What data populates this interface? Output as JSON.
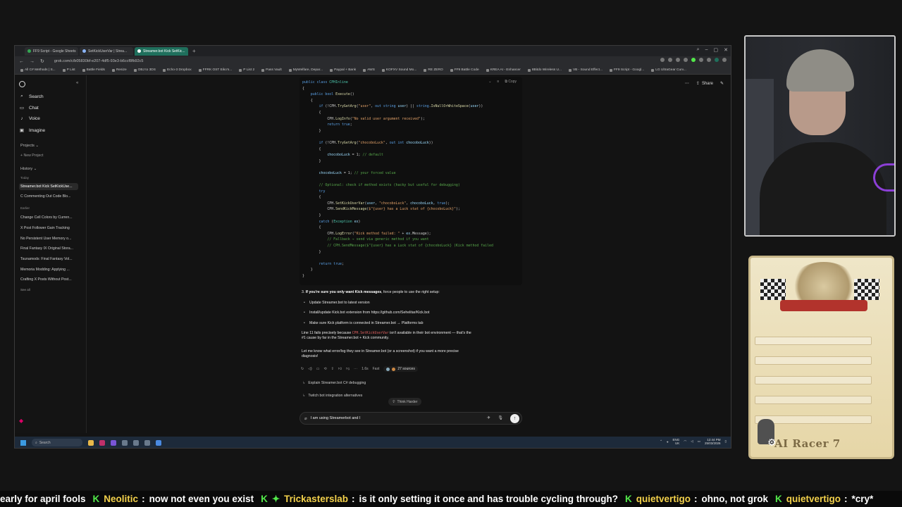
{
  "browser": {
    "tabs": [
      {
        "label": "FF9 Script - Google Sheets",
        "active": false
      },
      {
        "label": "SetKickUserVar | Strea...",
        "active": false
      },
      {
        "label": "Streamer.bot Kick SetKic...",
        "active": true
      }
    ],
    "url": "grok.com/c/b05830bf-e207-4df5-93e3-b6ccf8fb92c5",
    "bookmarks": [
      "All C# Methods | S...",
      "P List",
      "Battle Fields",
      "Resize",
      "OBJ to 3DS",
      "Echo-3 Dropbox",
      "FFRK OST Eiko's...",
      "P List 2",
      "Pass Vault",
      "MyWelfare, Depar...",
      "Paypal + Bank",
      "AWS",
      "KOFXV Sound Mo...",
      "RE ZERO",
      "FF9 Battle Code",
      "KREA AI - Enhancer",
      "8Bitdo Wireless U...",
      "VB - Sound Effect...",
      "FF9 Script - Googl...",
      "LG UltraGear Curv..."
    ]
  },
  "sidebar": {
    "nav": [
      {
        "label": "Search",
        "icon": "search-icon"
      },
      {
        "label": "Chat",
        "icon": "chat-icon"
      },
      {
        "label": "Voice",
        "icon": "voice-icon"
      },
      {
        "label": "Imagine",
        "icon": "image-icon"
      }
    ],
    "projects_label": "Projects",
    "new_project": "New Project",
    "history_label": "History",
    "today_label": "Today",
    "today_items": [
      "Streamer.bot Kick SetKickUse...",
      "C Commenting Out Code Blo..."
    ],
    "earlier_label": "Earlier",
    "earlier_items": [
      "Change Cell Colors by Curren...",
      "X Post Follower Gain Tracking",
      "No Persistent User Memory o...",
      "Final Fantasy IX Original Stora...",
      "Tsunamods: Final Fantasy Vol...",
      "Memoria Modding: Applying ...",
      "Crafting X Posts Without Post..."
    ],
    "see_all": "See all"
  },
  "header": {
    "share_label": "Share"
  },
  "code": {
    "collapse_label": "Ⅹ",
    "copy_label": "Copy"
  },
  "response": {
    "step3_num": "3.",
    "step3_bold": "If you're sure you only want Kick messages",
    "step3_rest": ", force people to use the right setup:",
    "bullets": [
      "Update Streamer.bot to latest version",
      "Install/update Kick.bot extension from https://github.com/Sehelitar/Kick.bot",
      "Make sure Kick platform is connected in Streamer.bot → Platforms tab"
    ],
    "line11_a": "Line 11 fails precisely because",
    "line11_code": "CPH.SetKickUserVar",
    "line11_b": "isn't available in their bot environment — that's the",
    "line11_c": "#1 cause by far in the Streamer.bot + Kick community.",
    "closing_1": "Let me know what error/log they see in Streamer.bot (or a screenshot) if you want a more precise",
    "closing_2": "diagnosis!",
    "speed": "1.6s",
    "mode": "Fast",
    "sources": "27 sources"
  },
  "suggestions": [
    "Explain Streamer.bot C# debugging",
    "Twitch bot integration alternatives"
  ],
  "think_harder": "Think Harder",
  "composer": {
    "value": "I am using Streamerbot and I"
  },
  "taskbar": {
    "search": "Search",
    "lang": "ENG",
    "region": "UK",
    "time": "12:44 PM",
    "date": "25/03/2026"
  },
  "overlay": {
    "card_title": "AI Racer 7"
  },
  "ticker": [
    {
      "user": "",
      "msg": "early for april fools"
    },
    {
      "user": "Neolitic",
      "msg": "now not even you exist"
    },
    {
      "user": "Trickasterslab",
      "msg": "is it only setting it once and has trouble cycling through?"
    },
    {
      "user": "quietvertigo",
      "msg": "ohno, not grok"
    },
    {
      "user": "quietvertigo",
      "msg": "*cry*"
    }
  ],
  "colors": {
    "ticker_user": "#f3d14b",
    "kick_green": "#52e84a",
    "active_tab": "#1f6f5c"
  }
}
